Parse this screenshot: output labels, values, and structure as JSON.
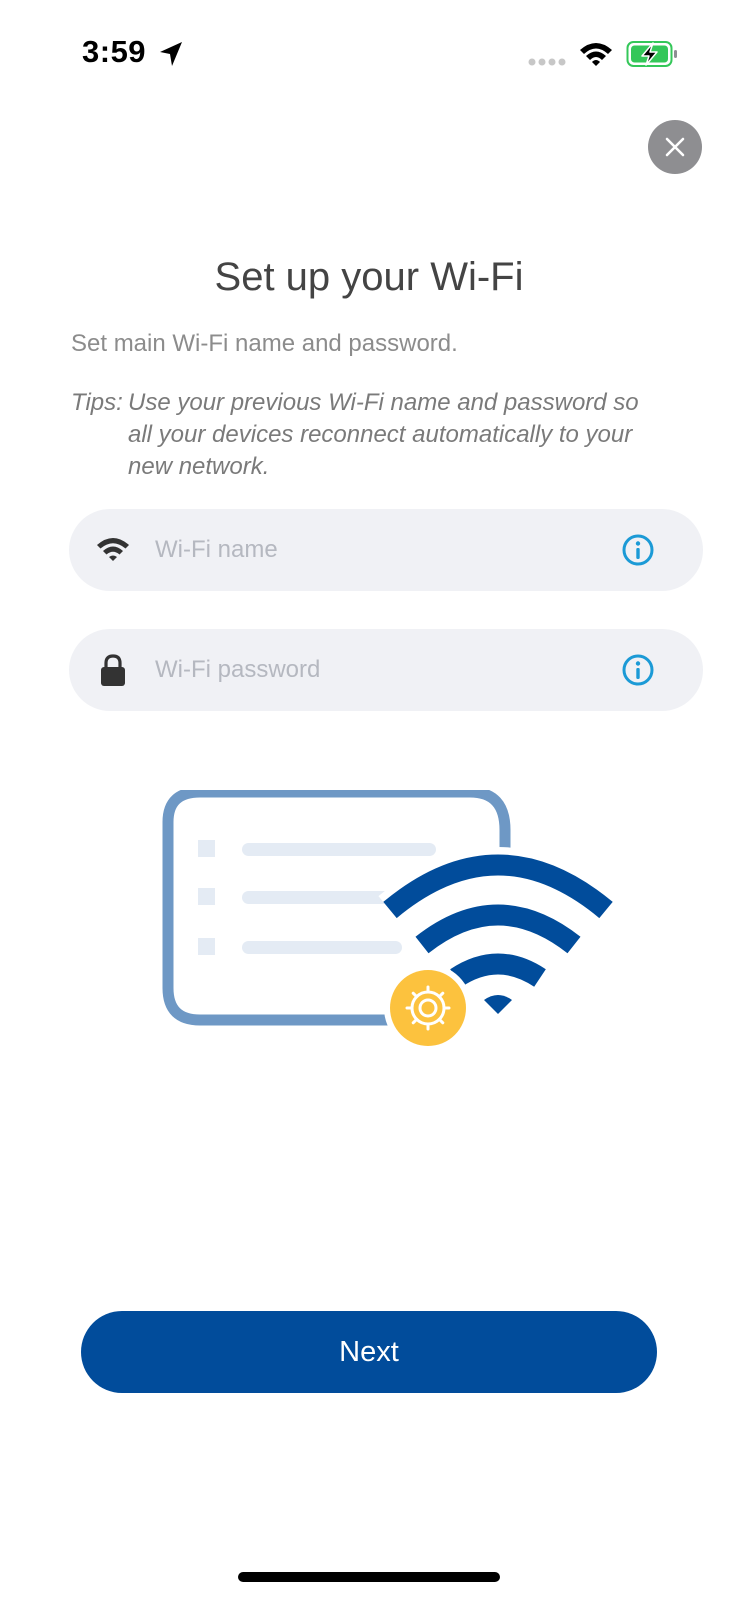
{
  "status_bar": {
    "time": "3:59",
    "icons": [
      "location-arrow-icon",
      "signal-dots-icon",
      "wifi-icon",
      "battery-charging-icon"
    ]
  },
  "header": {
    "close_icon": "close-icon",
    "title": "Set up your Wi-Fi"
  },
  "content": {
    "subtitle": "Set main Wi-Fi name and password.",
    "tips_prefix": "Tips:",
    "tips_body": "Use your previous Wi-Fi name and password so all your devices reconnect automatically to your new network."
  },
  "form": {
    "wifi_name": {
      "value": "",
      "placeholder": "Wi-Fi name",
      "icon": "wifi-icon",
      "info_icon": "info-icon"
    },
    "wifi_password": {
      "value": "",
      "placeholder": "Wi-Fi password",
      "icon": "lock-icon",
      "info_icon": "info-icon"
    }
  },
  "footer": {
    "next_label": "Next"
  },
  "colors": {
    "primary": "#014c9b",
    "info": "#1b9ad6",
    "gear_badge": "#fcc23e",
    "card_outline": "#6e98c5",
    "field_bg": "#f0f1f5"
  }
}
